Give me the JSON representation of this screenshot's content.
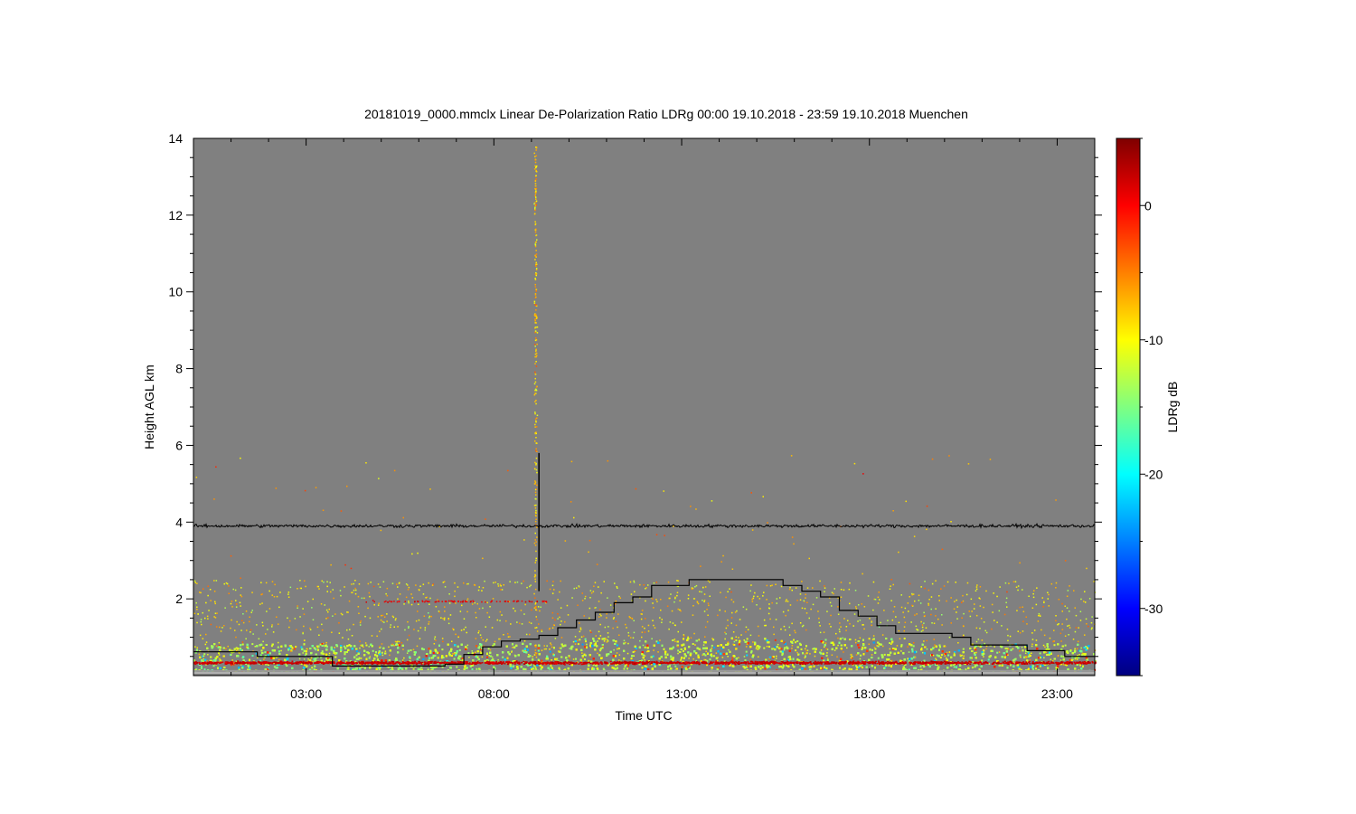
{
  "chart_data": {
    "type": "heatmap",
    "title": "20181019_0000.mmclx Linear De-Polarization Ratio LDRg   00:00 19.10.2018 - 23:59 19.10.2018 Muenchen",
    "xlabel": "Time UTC",
    "ylabel": "Height AGL km",
    "colorbar_label": "LDRg dB",
    "xlim_hours": [
      0,
      24
    ],
    "ylim": [
      0,
      14
    ],
    "x_ticks": [
      {
        "value": 3,
        "label": "03:00"
      },
      {
        "value": 8,
        "label": "08:00"
      },
      {
        "value": 13,
        "label": "13:00"
      },
      {
        "value": 18,
        "label": "18:00"
      },
      {
        "value": 23,
        "label": "23:00"
      }
    ],
    "y_ticks": [
      {
        "value": 2,
        "label": "2"
      },
      {
        "value": 4,
        "label": "4"
      },
      {
        "value": 6,
        "label": "6"
      },
      {
        "value": 8,
        "label": "8"
      },
      {
        "value": 10,
        "label": "10"
      },
      {
        "value": 12,
        "label": "12"
      },
      {
        "value": 14,
        "label": "14"
      }
    ],
    "colorbar_range": [
      -35,
      5
    ],
    "colorbar_ticks": [
      {
        "value": 0,
        "label": "0"
      },
      {
        "value": -10,
        "label": "-10"
      },
      {
        "value": -20,
        "label": "-20"
      },
      {
        "value": -30,
        "label": "-30"
      }
    ],
    "colormap": [
      "#00007f",
      "#0000ff",
      "#0080ff",
      "#00ffff",
      "#80ff80",
      "#ffff00",
      "#ff8000",
      "#ff0000",
      "#7f0000"
    ],
    "background_color": "#808080",
    "noise_line_height_km": 3.9,
    "vertical_spike": {
      "time": 9.2,
      "height_range": [
        2.2,
        5.8
      ]
    },
    "step_line": [
      [
        0,
        0.62
      ],
      [
        1.7,
        0.5
      ],
      [
        3.7,
        0.25
      ],
      [
        6.7,
        0.3
      ],
      [
        7.2,
        0.55
      ],
      [
        7.7,
        0.75
      ],
      [
        8.2,
        0.9
      ],
      [
        8.7,
        0.95
      ],
      [
        9.2,
        1.05
      ],
      [
        9.7,
        1.25
      ],
      [
        10.2,
        1.45
      ],
      [
        10.7,
        1.65
      ],
      [
        11.2,
        1.9
      ],
      [
        11.7,
        2.05
      ],
      [
        12.2,
        2.35
      ],
      [
        13.2,
        2.5
      ],
      [
        15.7,
        2.35
      ],
      [
        16.2,
        2.2
      ],
      [
        16.7,
        2.05
      ],
      [
        17.2,
        1.7
      ],
      [
        17.7,
        1.55
      ],
      [
        18.2,
        1.3
      ],
      [
        18.7,
        1.1
      ],
      [
        20.2,
        1.0
      ],
      [
        20.7,
        0.8
      ],
      [
        22.2,
        0.65
      ],
      [
        23.2,
        0.5
      ],
      [
        24,
        0.5
      ]
    ]
  }
}
